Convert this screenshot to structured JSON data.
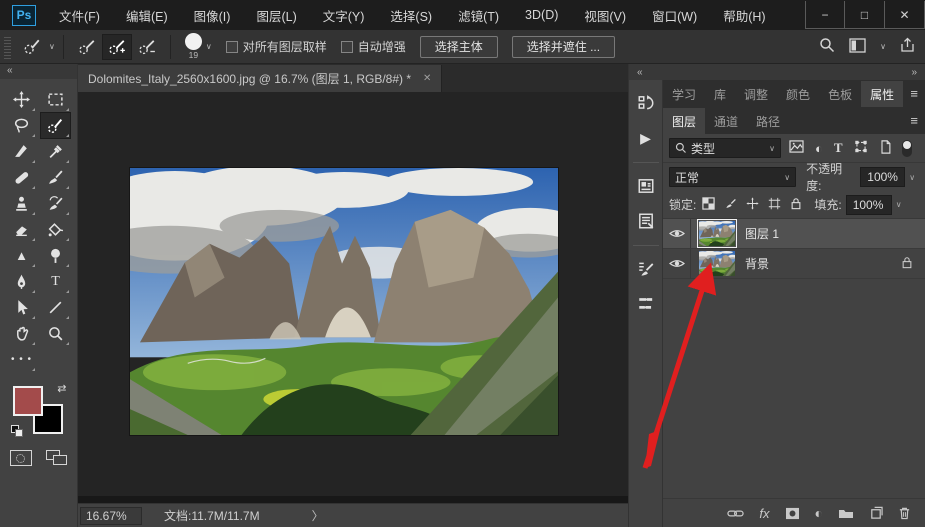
{
  "app": {
    "logo": "Ps",
    "window_controls": {
      "minimize": "−",
      "maximize": "□",
      "close": "✕"
    }
  },
  "menubar": {
    "items": [
      "文件(F)",
      "编辑(E)",
      "图像(I)",
      "图层(L)",
      "文字(Y)",
      "选择(S)",
      "滤镜(T)",
      "3D(D)",
      "视图(V)",
      "窗口(W)",
      "帮助(H)"
    ]
  },
  "options_bar": {
    "brush_size": "19",
    "sample_all_layers_label": "对所有图层取样",
    "auto_enhance_label": "自动增强",
    "select_subject_button": "选择主体",
    "select_and_mask_button": "选择并遮住 ..."
  },
  "document": {
    "tab_title": "Dolomites_Italy_2560x1600.jpg @ 16.7% (图层 1, RGB/8#) *"
  },
  "status_bar": {
    "zoom_level": "16.67%",
    "document_size": "文档:11.7M/11.7M",
    "chevron": "〉"
  },
  "panels": {
    "top_tabs": [
      "学习",
      "库",
      "调整",
      "颜色",
      "色板",
      "属性"
    ],
    "group_tabs": [
      "图层",
      "通道",
      "路径"
    ],
    "layers_panel": {
      "filter_kind": "类型",
      "blend_mode": "正常",
      "opacity_label": "不透明度:",
      "opacity_value": "100%",
      "lock_label": "锁定:",
      "fill_label": "填充:",
      "fill_value": "100%",
      "rows": [
        {
          "name": "图层 1"
        },
        {
          "name": "背景"
        }
      ]
    }
  },
  "glyphs": {
    "chevron_down": "∨",
    "hamburger": "≡",
    "collapse_left": "«",
    "expand_right": "»",
    "ellipsis": "• • •",
    "swap": "⇄",
    "triangle_tool": "▲",
    "line_tool": "╱",
    "type_tool": "T",
    "half_circle": "◐",
    "play": "▶",
    "fx": "fx",
    "tab_close": "✕"
  },
  "colors": {
    "foreground_swatch": "#a34b4b",
    "background_swatch": "#000000",
    "arrow_red": "#e01f1f",
    "logo_blue": "#43b2f1"
  }
}
